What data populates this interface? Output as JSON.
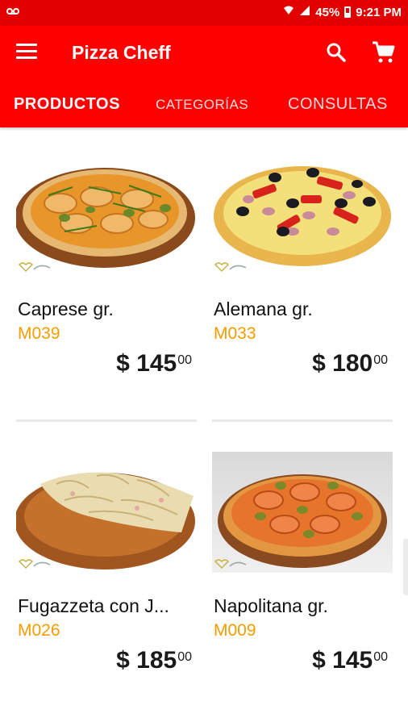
{
  "statusbar": {
    "left_icon": "voicemail-icon",
    "battery": "45%",
    "time": "9:21 PM"
  },
  "appbar": {
    "title": "Pizza Cheff"
  },
  "tabs": [
    {
      "label": "PRODUCTOS",
      "active": true
    },
    {
      "label": "CATEGORÍAS",
      "active": false
    },
    {
      "label": "CONSULTAS",
      "active": false
    }
  ],
  "products": [
    {
      "name": "Caprese gr.",
      "code": "M039",
      "price": "$ 145",
      "cents": "00"
    },
    {
      "name": "Alemana gr.",
      "code": "M033",
      "price": "$ 180",
      "cents": "00"
    },
    {
      "name": "Fugazzeta con J...",
      "code": "M026",
      "price": "$ 185",
      "cents": "00"
    },
    {
      "name": "Napolitana gr.",
      "code": "M009",
      "price": "$ 145",
      "cents": "00"
    }
  ],
  "colors": {
    "primary": "#ff0000",
    "code": "#f59c00"
  }
}
